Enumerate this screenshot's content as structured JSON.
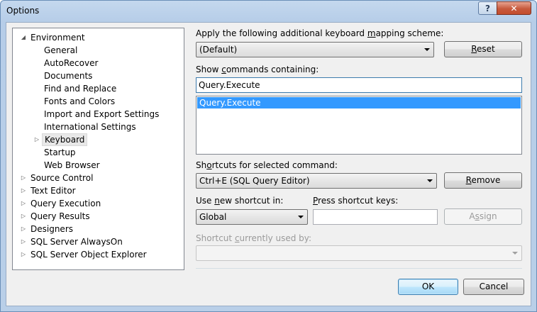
{
  "window": {
    "title": "Options",
    "help_glyph": "?",
    "close_glyph": "✕"
  },
  "tree": {
    "items": [
      {
        "label": "Environment",
        "expanded": true,
        "level": 0
      },
      {
        "label": "General",
        "level": 1
      },
      {
        "label": "AutoRecover",
        "level": 1
      },
      {
        "label": "Documents",
        "level": 1
      },
      {
        "label": "Find and Replace",
        "level": 1
      },
      {
        "label": "Fonts and Colors",
        "level": 1
      },
      {
        "label": "Import and Export Settings",
        "level": 1
      },
      {
        "label": "International Settings",
        "level": 1
      },
      {
        "label": "Keyboard",
        "level": 1,
        "selected": true
      },
      {
        "label": "Startup",
        "level": 1
      },
      {
        "label": "Web Browser",
        "level": 1
      },
      {
        "label": "Source Control",
        "level": 0
      },
      {
        "label": "Text Editor",
        "level": 0
      },
      {
        "label": "Query Execution",
        "level": 0
      },
      {
        "label": "Query Results",
        "level": 0
      },
      {
        "label": "Designers",
        "level": 0
      },
      {
        "label": "SQL Server AlwaysOn",
        "level": 0
      },
      {
        "label": "SQL Server Object Explorer",
        "level": 0
      }
    ]
  },
  "mapping": {
    "label_pre": "Apply the following additional keyboard ",
    "label_key": "m",
    "label_post": "apping scheme:",
    "value": "(Default)"
  },
  "reset_button": {
    "key": "R",
    "rest": "eset"
  },
  "commands": {
    "label_pre": "Show ",
    "label_key": "c",
    "label_post": "ommands containing:",
    "filter_value": "Query.Execute",
    "items": [
      "Query.Execute"
    ]
  },
  "shortcuts": {
    "label_pre": "Sh",
    "label_key": "o",
    "label_post": "rtcuts for selected command:",
    "value": "Ctrl+E (SQL Query Editor)"
  },
  "remove_button": {
    "key": "R",
    "rest": "emove"
  },
  "use_new": {
    "label_pre": "Use ",
    "label_key": "n",
    "label_post": "ew shortcut in:",
    "value": "Global"
  },
  "press_keys": {
    "label_pre": "",
    "label_key": "P",
    "label_post": "ress shortcut keys:",
    "value": ""
  },
  "assign_button": {
    "pre": "A",
    "key": "s",
    "rest": "sign"
  },
  "currently_used": {
    "label_pre": "Shortcut ",
    "label_key": "c",
    "label_post": "urrently used by:",
    "value": ""
  },
  "ok_button": "OK",
  "cancel_button": "Cancel"
}
